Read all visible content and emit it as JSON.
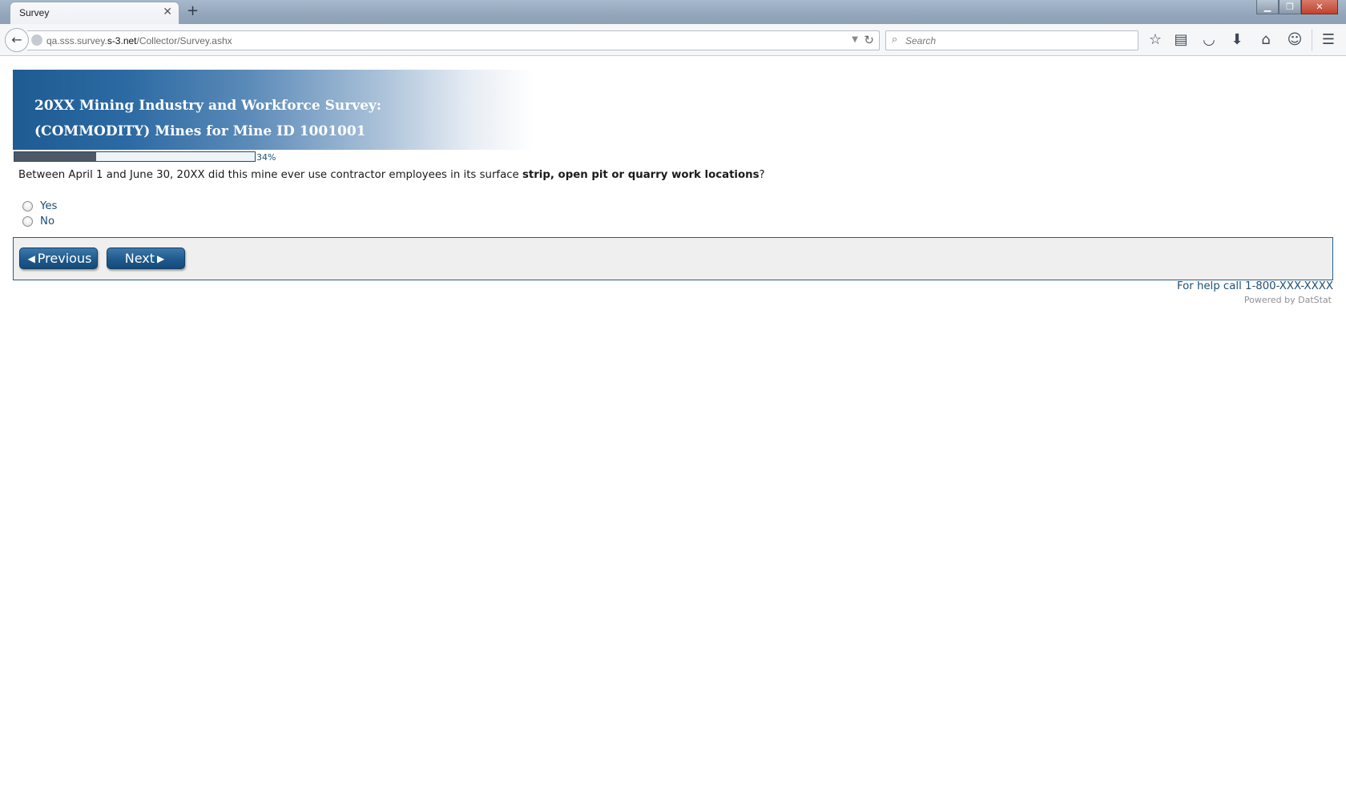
{
  "browser": {
    "tab_title": "Survey",
    "tab_close": "✕",
    "new_tab": "+",
    "url_prefix": "qa.sss.survey.",
    "url_domain": "s-3.net",
    "url_path": "/Collector/Survey.ashx",
    "search_placeholder": "Search",
    "window_controls": {
      "minimize": "▁",
      "restore": "❐",
      "close": "✕"
    }
  },
  "survey": {
    "title_line1": "20XX Mining Industry and Workforce Survey:",
    "title_line2": "(COMMODITY) Mines for Mine ID 1001001",
    "progress": {
      "percent": 34,
      "label": "34%"
    },
    "question": {
      "prefix": "Between April 1 and June 30, 20XX did this mine ever use contractor employees in its surface ",
      "bold": "strip, open pit or quarry work locations",
      "suffix": "?"
    },
    "options": [
      {
        "label": "Yes",
        "selected": false
      },
      {
        "label": "No",
        "selected": false
      }
    ],
    "previous_label": "Previous",
    "next_label": "Next",
    "help_text": "For help call 1-800-XXX-XXXX",
    "powered_by": "Powered by DatStat"
  },
  "colors": {
    "banner_blue": "#1e5b93",
    "button_blue": "#1f5a8d",
    "progress_fill": "#4d5966",
    "panel_border": "#245e8b"
  }
}
